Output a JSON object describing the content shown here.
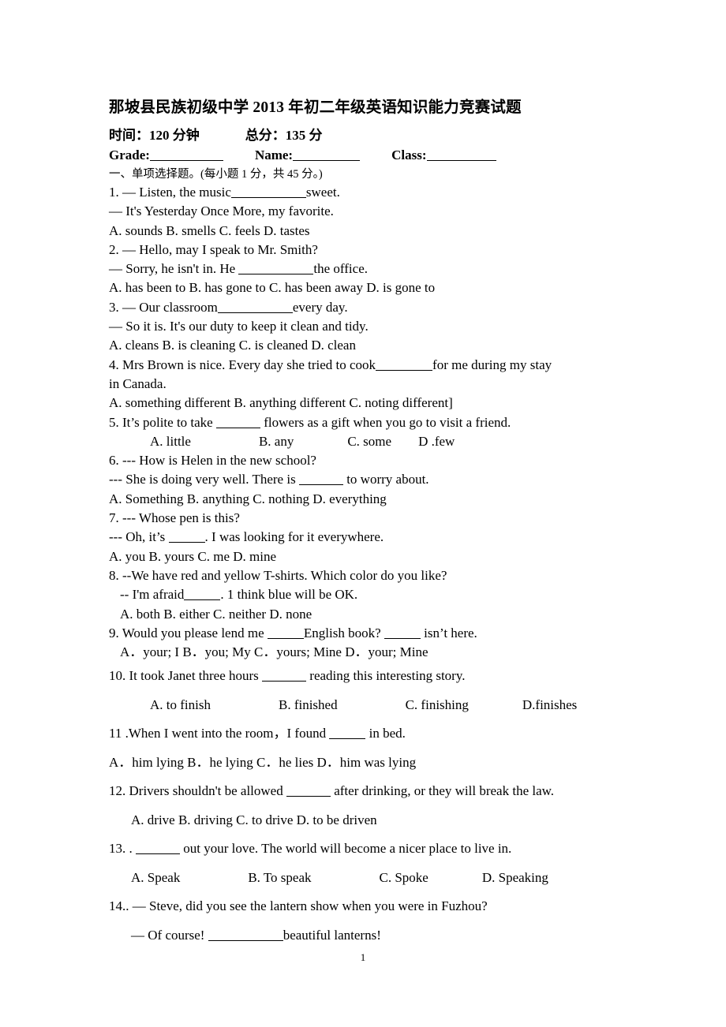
{
  "document": {
    "title": "那坡县民族初级中学 2013 年初二年级英语知识能力竞赛试题",
    "page_number": "1",
    "meta": {
      "time_label": "时间：120 分钟",
      "total_label": "总分：135 分",
      "grade_label": "Grade:",
      "name_label": "Name:",
      "class_label": "Class:"
    },
    "section_heading": "一、单项选择题。(每小题 1 分，共 45 分。)",
    "questions": [
      {
        "number": "1.",
        "stem": "— Listen, the music",
        "stem_tail": "sweet.",
        "reply": "— It's Yesterday Once More, my favorite.",
        "options_line": "A. sounds      B. smells      C. feels      D. tastes",
        "options": [
          "A. sounds",
          "B. smells",
          "C. feels",
          "D. tastes"
        ]
      },
      {
        "number": "2.",
        "stem": "— Hello, may I speak to Mr. Smith?",
        "reply_head": "— Sorry, he isn't in. He",
        "reply_tail": "the office.",
        "options_line": "A. has been to      B. has gone to      C. has been away      D. is gone to",
        "options": [
          "A. has been to",
          "B. has gone to",
          "C. has been away",
          "D. is gone to"
        ]
      },
      {
        "number": "3.",
        "stem": "— Our classroom",
        "stem_tail": "every day.",
        "reply": "— So it is. It's our duty to keep it clean and tidy.",
        "options_line": "A. cleans      B. is cleaning      C. is cleaned    D. clean",
        "options": [
          "A. cleans",
          "B. is cleaning",
          "C. is cleaned",
          "D. clean"
        ]
      },
      {
        "number": "4.",
        "stem": "Mrs Brown is nice. Every day she tried to cook",
        "stem_tail": "for me during my stay",
        "stem_wrap": "in Canada.",
        "options_line": "A. something different      B. anything different      C. noting different]",
        "options": [
          "A. something different",
          "B. anything different",
          "C. noting different]"
        ]
      },
      {
        "number": "5.",
        "stem": "It’s polite to take",
        "stem_tail": "flowers as a gift when you go to visit a friend.",
        "options_line": "A. little      B. any      C. some      D .few",
        "options": [
          "A. little",
          "B. any",
          "C. some",
          "D .few"
        ]
      },
      {
        "number": "6.",
        "stem": "--- How is Helen in the new school?",
        "reply_head": "--- She is doing very well. There is",
        "reply_tail": "to worry about.",
        "options_line": "A.  Something      B. anything      C. nothing      D. everything",
        "options": [
          "A.  Something",
          "B. anything",
          "C. nothing",
          "D. everything"
        ]
      },
      {
        "number": "7.",
        "stem": "--- Whose pen is this?",
        "reply_head": "--- Oh, it’s",
        "reply_tail": ". I was looking for it everywhere.",
        "options_line": "A.  you      B. yours      C. me      D. mine",
        "options": [
          "A.  you",
          "B. yours",
          "C. me",
          "D. mine"
        ]
      },
      {
        "number": "8.",
        "stem": "--We have red and yellow T-shirts. Which color do you like?",
        "reply_head": "-- I'm afraid",
        "reply_tail": ". 1 think blue will be OK.",
        "options_line": "A. both    B. either    C. neither     D. none",
        "options": [
          "A. both",
          "B. either",
          "C. neither",
          "D. none"
        ]
      },
      {
        "number": "9.",
        "stem_head": "Would you please lend me",
        "stem_mid": "English book?",
        "stem_tail": "isn’t here.",
        "options_line": "A．your; I      B．you; My      C．yours; Mine      D．your; Mine",
        "options": [
          "A．your; I",
          "B．you; My",
          "C．yours; Mine",
          "D．your; Mine"
        ]
      },
      {
        "number": "10.",
        "stem_head": "It took Janet three hours",
        "stem_tail": "reading this interesting story.",
        "options_line": "A. to finish         B. finished         C. finishing      D.finishes",
        "options": [
          "A. to finish",
          "B. finished",
          "C. finishing",
          "D.finishes"
        ]
      },
      {
        "number": "11 .",
        "stem_head": "When I went into the room，I found",
        "stem_tail": "in bed.",
        "options_line": "A．him lying    B．he lying C．he lies      D．him was lying",
        "options": [
          "A．him lying",
          "B．he lying C．he lies",
          "D．him was lying"
        ]
      },
      {
        "number": "12.",
        "stem_head": "Drivers shouldn't be allowed",
        "stem_tail": "after drinking, or they will break the law.",
        "options_line": "A. drive      B. driving      C. to drive      D. to be driven",
        "options": [
          "A. drive",
          "B. driving",
          "C. to drive",
          "D. to be driven"
        ]
      },
      {
        "number": "13. .",
        "stem_tail": "out your love. The world will become a nicer place to live in.",
        "options_line": "A. Speak         B. To speak         C. Spoke      D. Speaking",
        "options": [
          "A. Speak",
          "B. To speak",
          "C. Spoke",
          "D. Speaking"
        ]
      },
      {
        "number": "14..",
        "stem": "— Steve, did you see the lantern show when you were in Fuzhou?",
        "reply_head": "— Of course!",
        "reply_tail": "beautiful lanterns!"
      }
    ]
  }
}
